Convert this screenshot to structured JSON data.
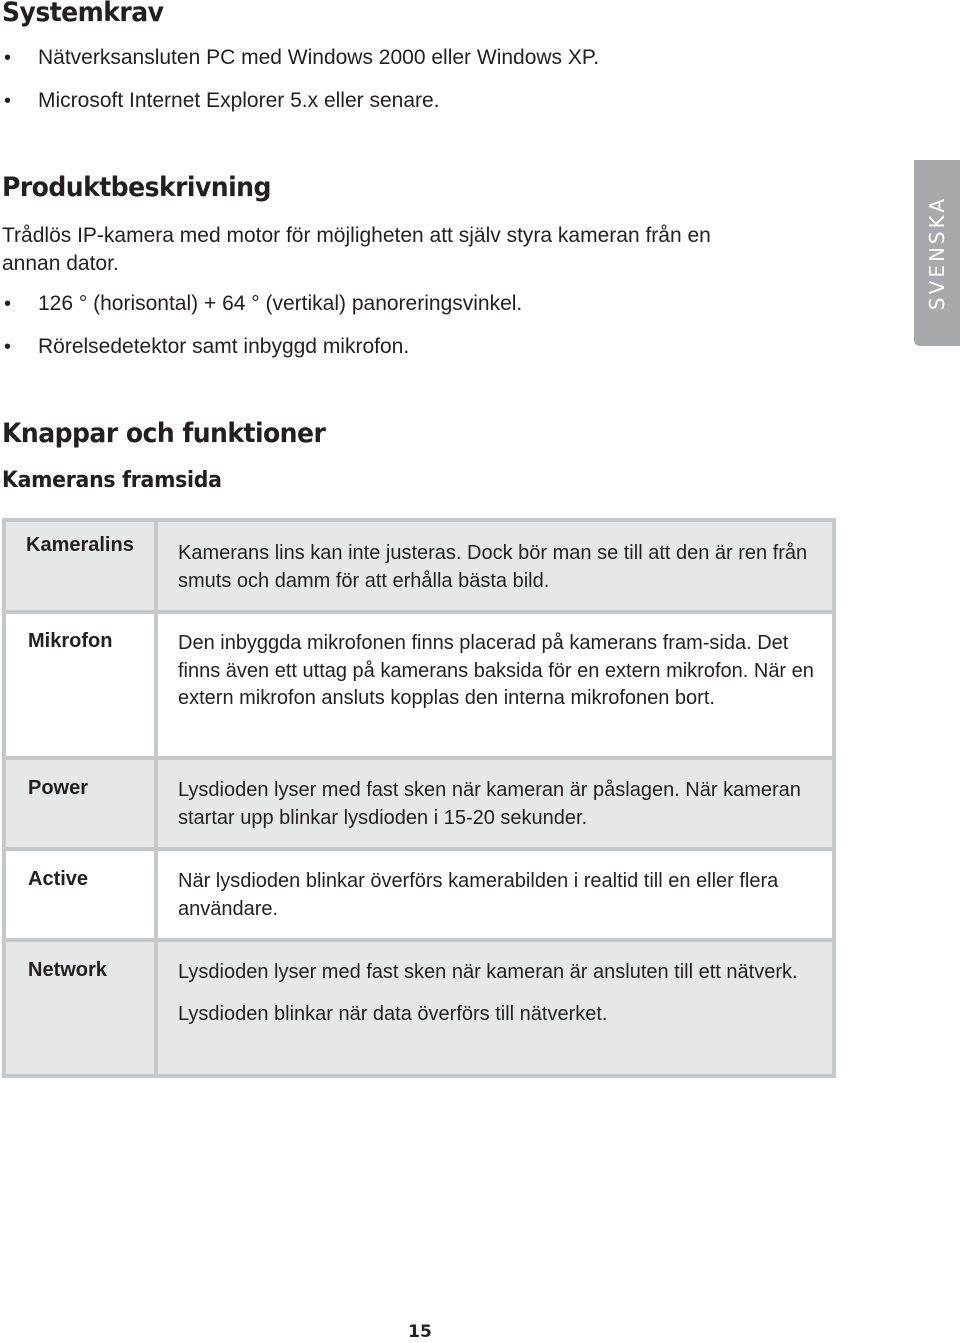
{
  "side_tab": {
    "label": "SVENSKA",
    "color": "#a7a9ac"
  },
  "system_requirements": {
    "heading": "Systemkrav",
    "items": [
      "Nätverksansluten PC med Windows 2000 eller Windows XP.",
      "Microsoft Internet Explorer 5.x eller senare."
    ]
  },
  "product_description": {
    "heading": "Produktbeskrivning",
    "paragraph": "Trådlös IP-kamera med motor för möjligheten att själv styra kameran från en annan dator.",
    "items": [
      "126 ° (horisontal) + 64 ° (vertikal) panoreringsvinkel.",
      "Rörelsedetektor samt inbyggd mikrofon."
    ]
  },
  "buttons_functions": {
    "heading": "Knappar och funktioner",
    "subheading": "Kamerans framsida",
    "table": {
      "rows": [
        {
          "label": "Kameralins",
          "description": [
            "Kamerans lins kan inte justeras. Dock bör man se till att den är ren från smuts och damm för att erhålla bästa bild."
          ]
        },
        {
          "label": "Mikrofon",
          "description": [
            "Den inbyggda mikrofonen finns placerad på kamerans fram-sida. Det finns även ett uttag på kamerans baksida för en extern mikrofon. När en extern mikrofon ansluts kopplas den interna mikrofonen bort."
          ]
        },
        {
          "label": "Power",
          "description": [
            "Lysdioden lyser med fast sken när kameran är påslagen. När kameran startar upp blinkar lysdioden i 15-20 sekunder."
          ]
        },
        {
          "label": "Active",
          "description": [
            "När lysdioden blinkar överförs kamerabilden i realtid till en eller flera användare."
          ]
        },
        {
          "label": "Network",
          "description": [
            "Lysdioden lyser med fast sken när kameran är ansluten till ett nätverk.",
            "Lysdioden blinkar när data överförs till nätverket."
          ]
        }
      ]
    }
  },
  "footer": {
    "page_number": "15"
  }
}
